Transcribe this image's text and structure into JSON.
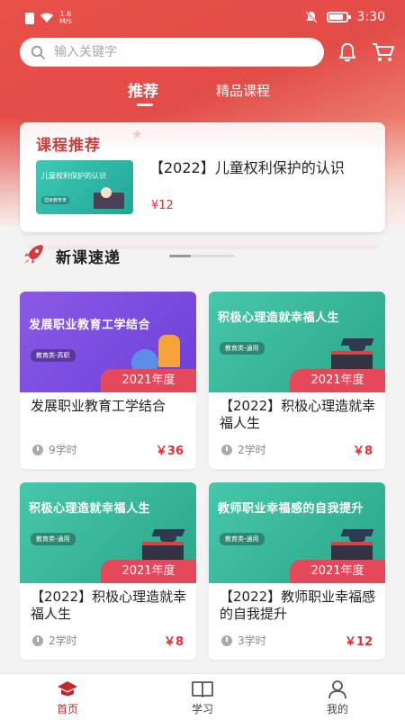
{
  "status": {
    "speed_value": "1.6",
    "speed_unit": "M/s",
    "time": "3:30"
  },
  "search": {
    "placeholder": "输入关键字"
  },
  "tabs": [
    {
      "label": "推荐",
      "active": true
    },
    {
      "label": "精品课程",
      "active": false
    }
  ],
  "recommend": {
    "section_title": "课程推荐",
    "course": {
      "thumb_title": "儿童权利保护的认识",
      "thumb_tag": "国家教育类",
      "title": "【2022】儿童权利保护的认识",
      "price": "¥12"
    }
  },
  "new_courses": {
    "section_title": "新课速递",
    "scroll_progress": 0.33,
    "items": [
      {
        "cover_title": "发展职业教育工学结合",
        "cover_tag": "教育类-高职",
        "year": "2021年度",
        "title": "发展职业教育工学结合",
        "hours": "9学时",
        "price": "￥36",
        "theme": "purple"
      },
      {
        "cover_title": "积极心理造就幸福人生",
        "cover_tag": "教育类-通用",
        "year": "2021年度",
        "title": "【2022】积极心理造就幸福人生",
        "hours": "2学时",
        "price": "￥8",
        "theme": "green"
      },
      {
        "cover_title": "积极心理造就幸福人生",
        "cover_tag": "教育类-通用",
        "year": "2021年度",
        "title": "【2022】积极心理造就幸福人生",
        "hours": "2学时",
        "price": "￥8",
        "theme": "green"
      },
      {
        "cover_title": "教师职业幸福感的自我提升",
        "cover_tag": "教育类-通用",
        "year": "2021年度",
        "title": "【2022】教师职业幸福感的自我提升",
        "hours": "3学时",
        "price": "￥12",
        "theme": "green"
      }
    ]
  },
  "bottom_nav": [
    {
      "label": "首页",
      "icon": "home-icon",
      "active": true
    },
    {
      "label": "学习",
      "icon": "book-icon",
      "active": false
    },
    {
      "label": "我的",
      "icon": "user-icon",
      "active": false
    }
  ],
  "colors": {
    "brand_red": "#e24c47",
    "price_red": "#d33",
    "year_badge": "#e5485a",
    "active_nav": "#c1272d"
  }
}
